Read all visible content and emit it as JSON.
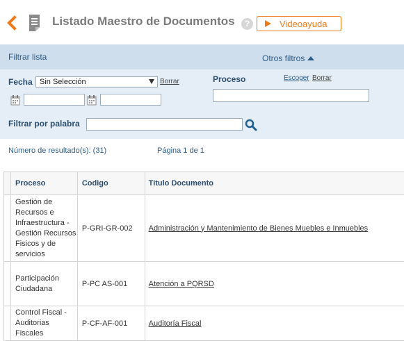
{
  "header": {
    "title": "Listado Maestro de Documentos",
    "help_glyph": "?",
    "video_label": "Videoayuda"
  },
  "filters": {
    "title": "Filtrar lista",
    "otros_label": "Otros filtros",
    "fecha_label": "Fecha",
    "fecha_select_value": "Sin Selección",
    "fecha_borrar": "Borrar",
    "date_from_value": "",
    "date_to_value": "",
    "proceso_label": "Proceso",
    "proceso_escoger": "Escoger",
    "proceso_borrar": "Borrar",
    "proceso_value": "",
    "palabra_label": "Filtrar por palabra",
    "palabra_value": ""
  },
  "results": {
    "count_text": "Número de resultado(s): (31)",
    "page_text": "Página 1 de 1"
  },
  "table": {
    "headers": [
      "Proceso",
      "Codigo",
      "Titulo Documento"
    ],
    "rows": [
      {
        "proceso": "Gestión de Recursos e Infraestructura - Gestión Recursos Fisicos y de servicios",
        "codigo": "P-GRI-GR-002",
        "titulo": "Administración y Mantenimiento de Bienes Muebles e Inmuebles"
      },
      {
        "proceso": "Participación Ciudadana",
        "codigo": "P-PC AS-001",
        "titulo": "Atención a PQRSD"
      },
      {
        "proceso": "Control Fiscal - Auditorias Fiscales",
        "codigo": "P-CF-AF-001",
        "titulo": "Auditoría Fiscal"
      }
    ]
  },
  "colors": {
    "accent_orange": "#f07a1a",
    "filter_bar": "#cfdeec",
    "filter_panel": "#e5eef6",
    "link_blue": "#2b5c88"
  },
  "icons": [
    "back-chevron-icon",
    "document-icon",
    "help-icon",
    "play-icon",
    "triangle-up-icon",
    "calendar-icon",
    "search-icon"
  ]
}
